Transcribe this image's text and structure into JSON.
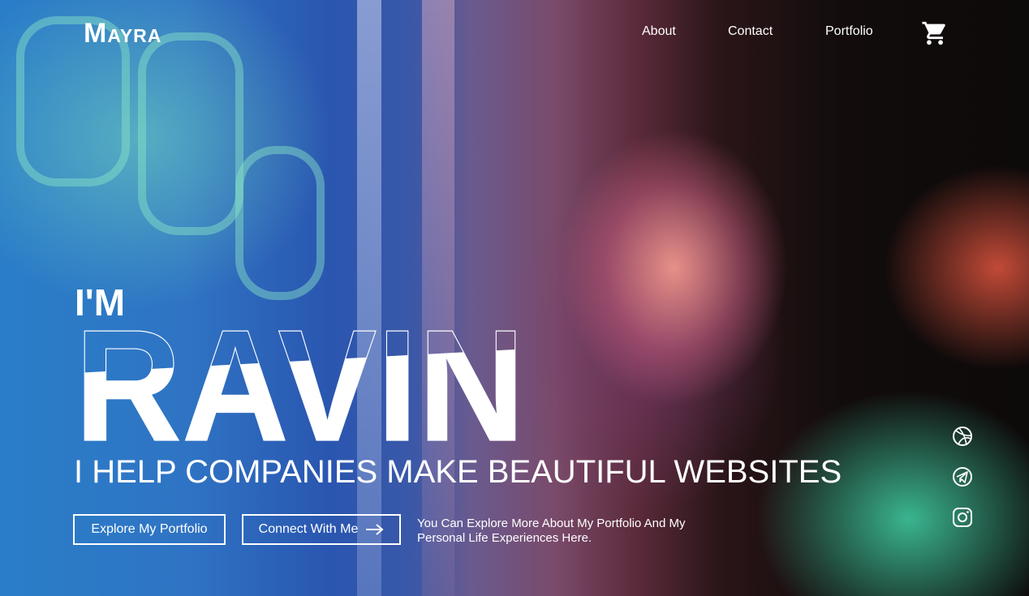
{
  "brand": {
    "initial": "M",
    "rest": "AYRA"
  },
  "nav": {
    "about": "About",
    "contact": "Contact",
    "portfolio": "Portfolio"
  },
  "hero": {
    "intro": "I'M",
    "name": "RAVIN",
    "tagline": "I HELP COMPANIES MAKE BEAUTIFUL WEBSITES",
    "explore_button": "Explore My Portfolio",
    "connect_button": "Connect With Me",
    "description": "You Can Explore More About My Portfolio And My Personal Life Experiences Here."
  },
  "icons": {
    "cart": "cart-icon",
    "arrow": "arrow-right-icon",
    "social": [
      "dribbble-icon",
      "telegram-icon",
      "instagram-icon"
    ]
  },
  "colors": {
    "text": "#ffffff",
    "outline": "#ffffff"
  }
}
